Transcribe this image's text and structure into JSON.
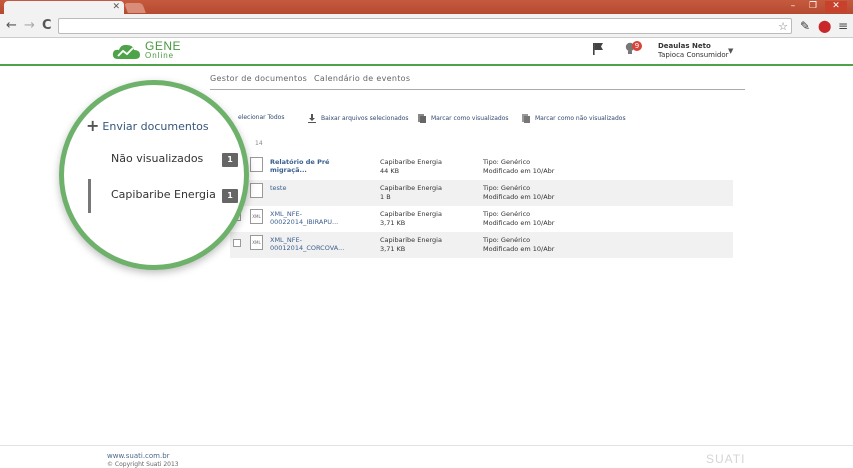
{
  "browser": {
    "nav": {
      "back": "←",
      "forward": "→",
      "reload": "C"
    }
  },
  "header": {
    "logo": {
      "line1": "GENE",
      "line2": "Online"
    },
    "notification_count": "9",
    "user_name": "Deaulas Neto",
    "user_company": "Tapioca Consumidor",
    "colors": {
      "accent": "#4ea34a",
      "badge": "#d9443a"
    }
  },
  "tabs": [
    {
      "label": "Gestor de documentos"
    },
    {
      "label": "Calendário de eventos"
    }
  ],
  "actions": [
    {
      "label": "elecionar Todos"
    },
    {
      "label": "Baixar arquivos selecionados",
      "icon": "download-icon"
    },
    {
      "label": "Marcar como visualizados",
      "icon": "doc-check-icon"
    },
    {
      "label": "Marcar como não visualizados",
      "icon": "doc-copy-icon"
    }
  ],
  "list_label": "14",
  "documents": [
    {
      "title": "Relatório de Pré migraçã...",
      "owner": "Capibaribe Energia",
      "size": "44 KB",
      "type": "Tipo: Genérico",
      "modified": "Modificado em 10/Abr",
      "bold": true,
      "icon_label": ""
    },
    {
      "title": "teste",
      "owner": "Capibaribe Energia",
      "size": "1 B",
      "type": "Tipo: Genérico",
      "modified": "Modificado em 10/Abr",
      "bold": false,
      "icon_label": ""
    },
    {
      "title": "XML_NFE-00022014_IBIRAPU...",
      "owner": "Capibaribe Energia",
      "size": "3,71 KB",
      "type": "Tipo: Genérico",
      "modified": "Modificado em 10/Abr",
      "bold": false,
      "icon_label": "XML"
    },
    {
      "title": "XML_NFE-00012014_CORCOVA...",
      "owner": "Capibaribe Energia",
      "size": "3,71 KB",
      "type": "Tipo: Genérico",
      "modified": "Modificado em 10/Abr",
      "bold": false,
      "icon_label": "XML"
    }
  ],
  "sidebar": {
    "send_label": "Enviar documentos",
    "items": [
      {
        "label": "Não visualizados",
        "count": "1"
      },
      {
        "label": "Capibaribe Energia",
        "count": "1"
      }
    ]
  },
  "footer": {
    "link": "www.suati.com.br",
    "copyright": "© Copyright Suati 2013",
    "brand": "SUATI"
  }
}
